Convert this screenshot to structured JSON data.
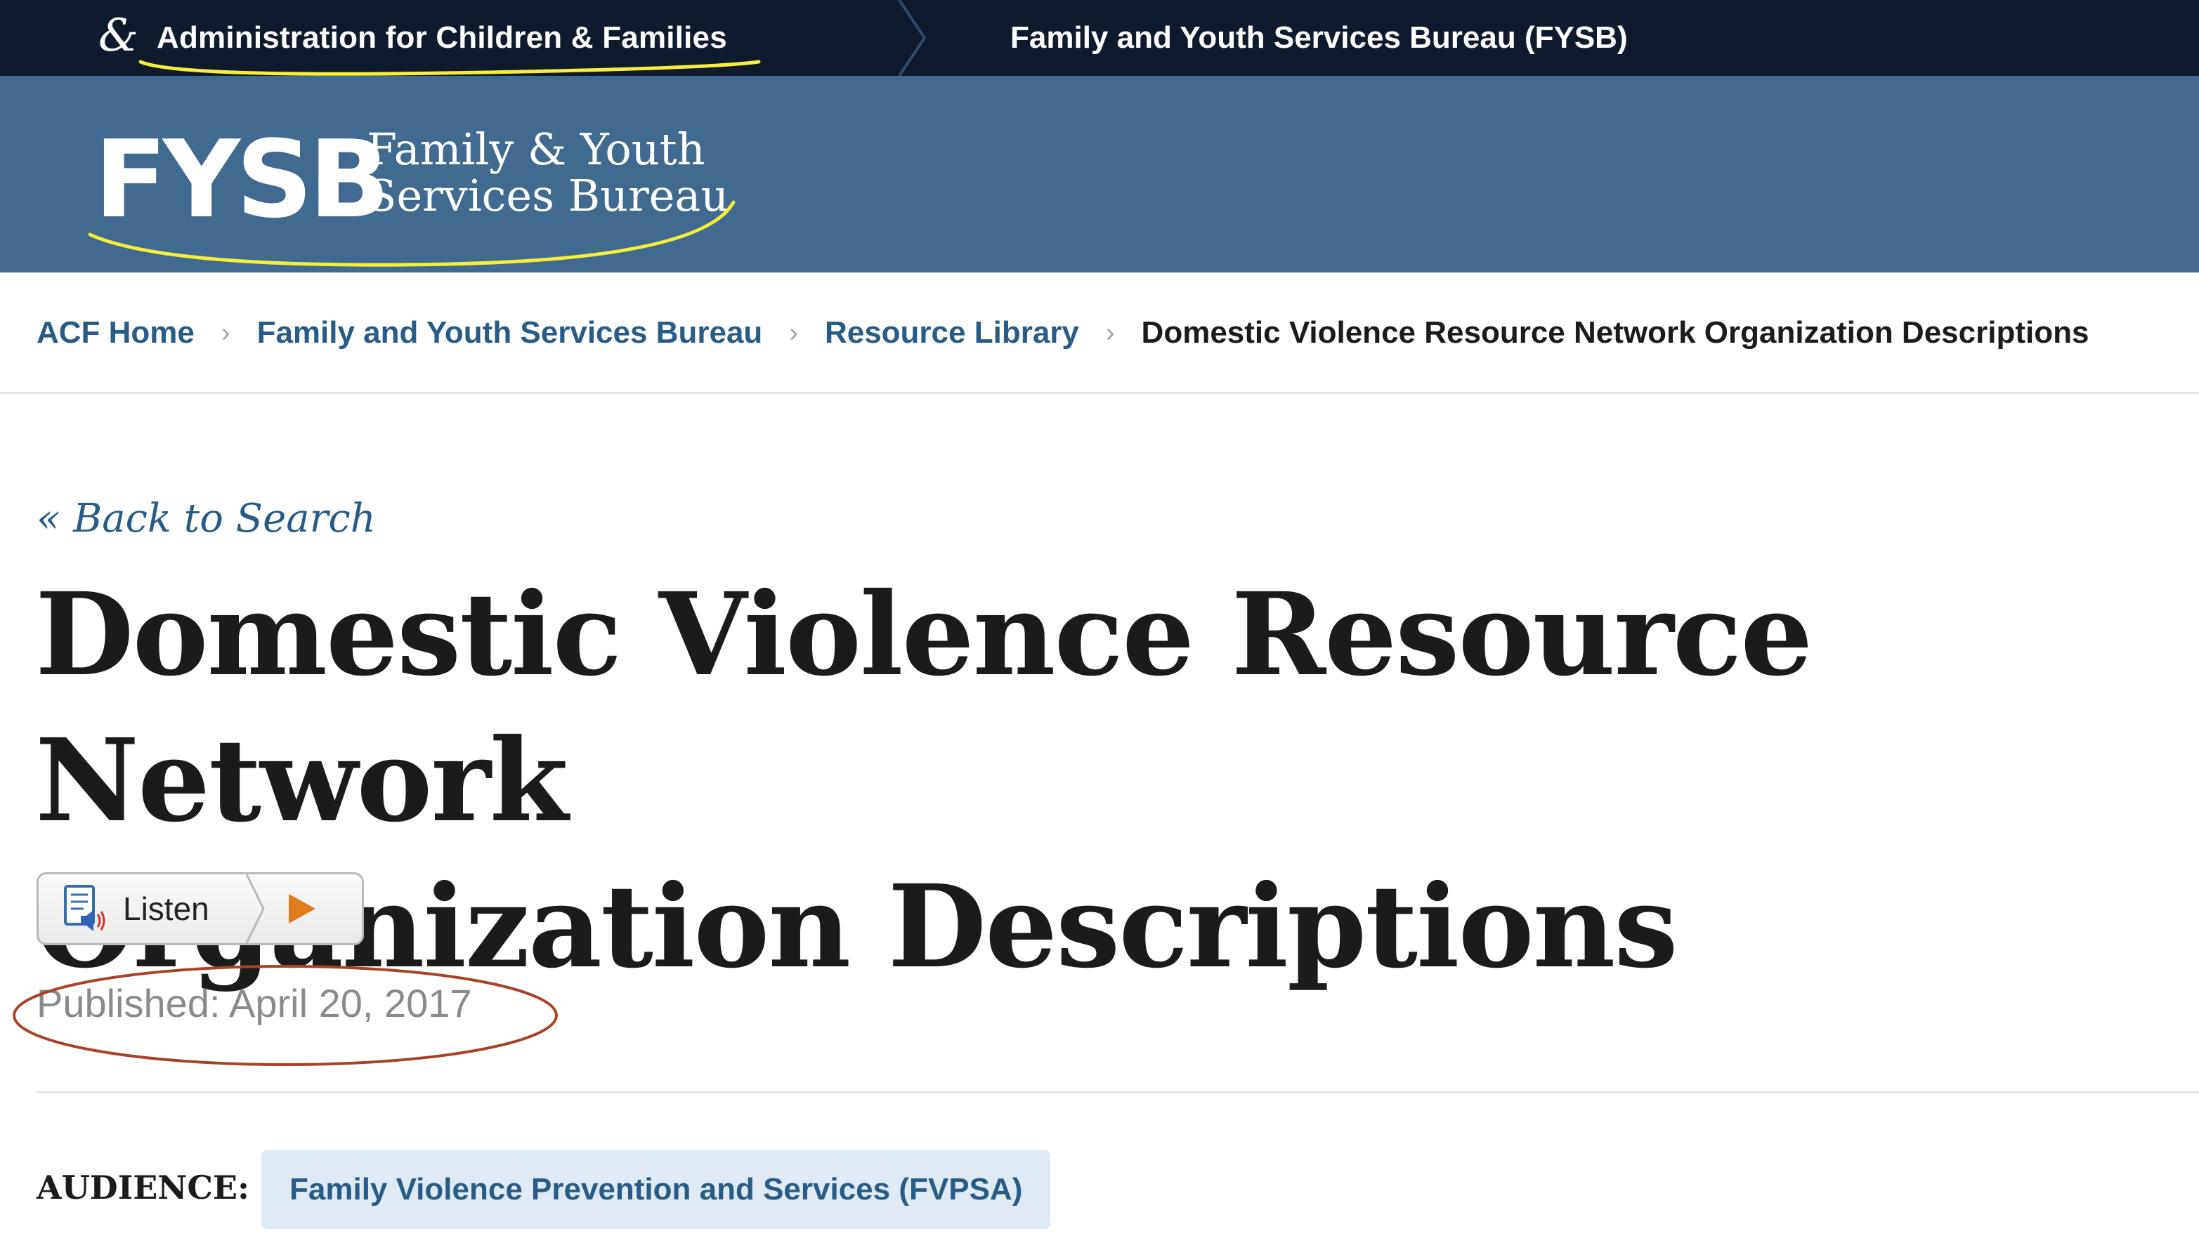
{
  "topbar": {
    "acf_label": "Administration for Children & Families",
    "bureau_label": "Family and Youth Services Bureau (FYSB)",
    "background": "#0f1b2d"
  },
  "brand": {
    "logo_mark": "FYSB",
    "logo_line1": "Family & Youth",
    "logo_line2": "Services Bureau",
    "background": "#42698f"
  },
  "breadcrumb": {
    "items": [
      {
        "label": "ACF Home"
      },
      {
        "label": "Family and Youth Services Bureau"
      },
      {
        "label": "Resource Library"
      }
    ],
    "separator": "›",
    "current": "Domestic Violence Resource Network Organization Descriptions"
  },
  "main": {
    "back_link": "« Back to Search",
    "title_line1": "Domestic Violence Resource Network",
    "title_line2": "Organization Descriptions",
    "listen_label": "Listen",
    "published": "Published: April 20, 2017",
    "audience_label": "AUDIENCE:",
    "audience_tag": "Family Violence Prevention and Services (FVPSA)"
  },
  "colors": {
    "link": "#2a5b87",
    "annotation_yellow": "#f5ee3a",
    "annotation_red": "#a8432a",
    "tag_background": "#dfeaf5"
  }
}
